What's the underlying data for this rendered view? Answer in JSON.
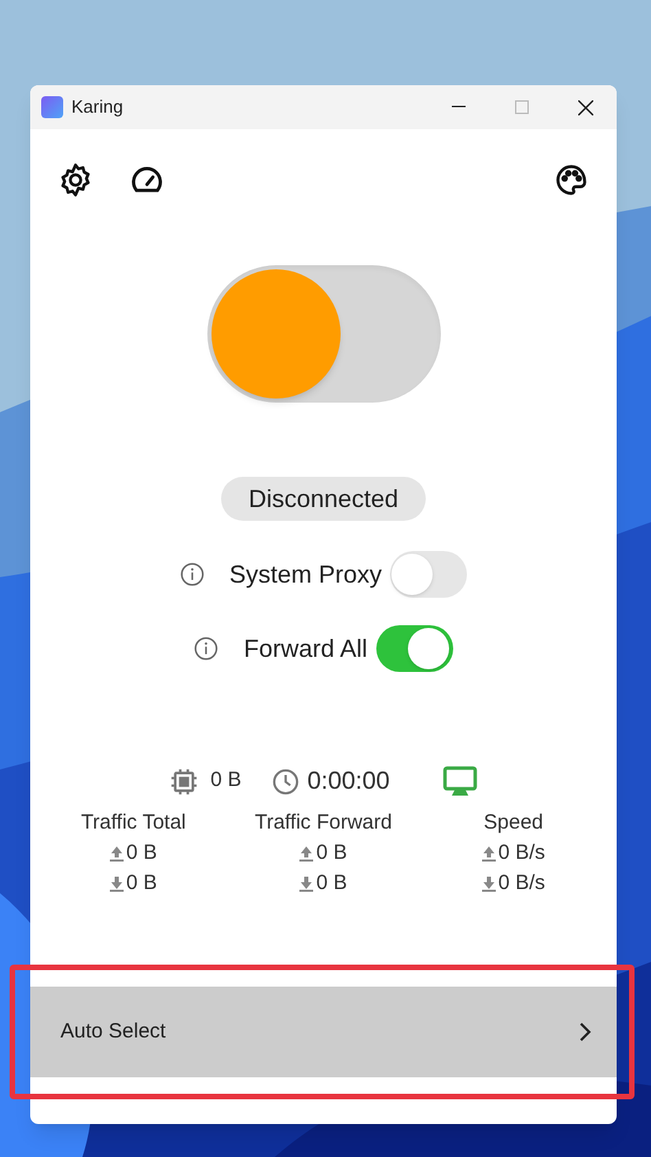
{
  "window": {
    "title": "Karing"
  },
  "main_switch": {
    "on": false
  },
  "status": "Disconnected",
  "toggles": [
    {
      "label": "System Proxy",
      "on": false
    },
    {
      "label": "Forward All",
      "on": true
    }
  ],
  "summary": {
    "memory": "0 B",
    "uptime": "0:00:00"
  },
  "traffic": [
    {
      "title": "Traffic Total",
      "upload": "0 B",
      "download": "0 B"
    },
    {
      "title": "Traffic Forward",
      "upload": "0 B",
      "download": "0 B"
    },
    {
      "title": "Speed",
      "upload": "0 B/s",
      "download": "0 B/s"
    }
  ],
  "server": {
    "label": "Auto Select",
    "highlighted": true
  }
}
